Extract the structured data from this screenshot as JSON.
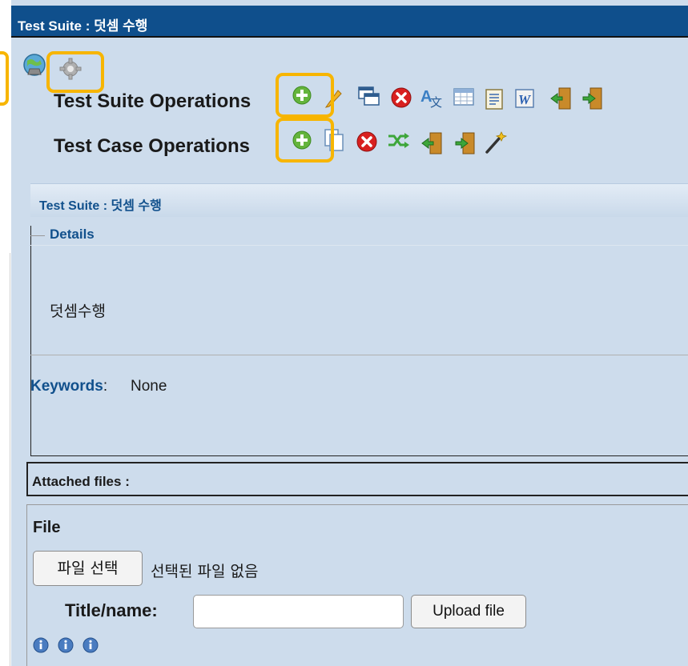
{
  "header": {
    "title": "Test Suite : 덧셈 수행"
  },
  "toolbar": {
    "icons": [
      "globe-icon",
      "gear-icon"
    ]
  },
  "suite_ops": {
    "label": "Test Suite Operations",
    "icons": [
      "add-icon",
      "edit-pencil-icon",
      "copy-window-icon",
      "delete-icon",
      "translate-icon",
      "table-icon",
      "document-icon",
      "word-export-icon",
      "import-icon",
      "export-icon"
    ]
  },
  "case_ops": {
    "label": "Test Case Operations",
    "icons": [
      "add-icon",
      "copy-pages-icon",
      "delete-icon",
      "shuffle-icon",
      "import-icon",
      "export-icon",
      "magic-wand-icon"
    ]
  },
  "section": {
    "title": "Test Suite : 덧셈 수행"
  },
  "details": {
    "legend": "Details",
    "description": "덧셈수행",
    "keywords_label": "Keywords",
    "keywords_sep": ":",
    "keywords_value": "None"
  },
  "attachments": {
    "header": "Attached files :",
    "file_label": "File",
    "choose_button": "파일 선택",
    "no_file_text": "선택된 파일 없음",
    "title_label": "Title/name:",
    "title_value": "",
    "upload_button": "Upload file",
    "info_icons": [
      "info-icon",
      "info-icon",
      "info-icon"
    ]
  },
  "colors": {
    "title_bar": "#0f4f8c",
    "panel_bg": "#cddcec",
    "link_blue": "#11508c",
    "highlight": "#f7b500",
    "delete_red": "#d8201f",
    "add_green": "#64b43c"
  }
}
